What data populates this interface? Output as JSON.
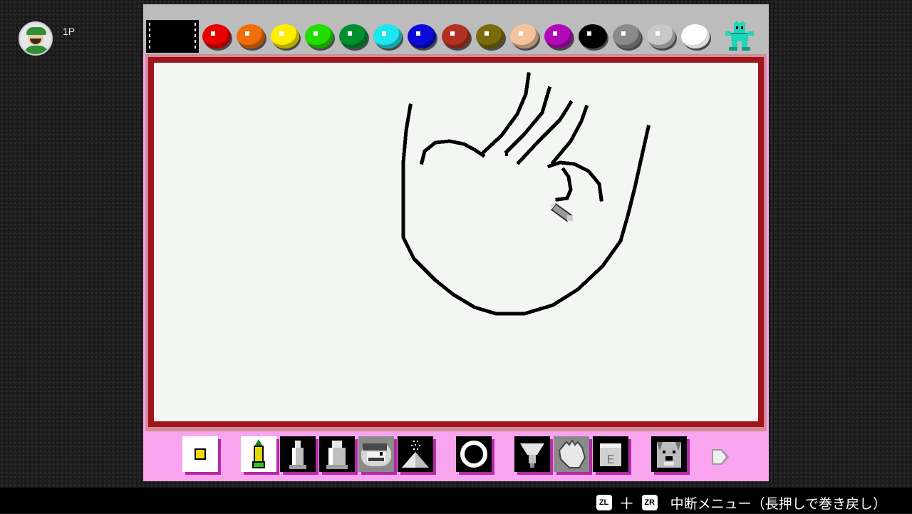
{
  "player": {
    "label": "1P",
    "avatar_icon": "mii-avatar-icon"
  },
  "palette": {
    "colors": [
      "#e80000",
      "#f06d0b",
      "#ffee00",
      "#22dd00",
      "#008f2f",
      "#1ee6ee",
      "#0a0ad8",
      "#b13222",
      "#7a6a0a",
      "#f4c39c",
      "#b00ab8",
      "#000000",
      "#8a8a8a",
      "#c8c8c8",
      "#ffffff"
    ],
    "stamp_icon": "robot-stamp-icon",
    "film_icon": "film-strip-icon"
  },
  "colors": {
    "frame_red": "#a1141c",
    "toolbar_pink": "#f8a4ef",
    "toolbar_shadow": "#b32aa9",
    "canvas": "#f4f6f4"
  },
  "toolbar": {
    "tools": [
      "yellow-square-brush-icon",
      "pencil-icon",
      "marker-icon",
      "thick-marker-icon",
      "mario-stamp-icon",
      "spray-icon",
      "circle-shape-icon",
      "paint-bucket-icon",
      "hand-icon",
      "eraser-icon",
      "dog-stamp-icon"
    ],
    "next_icon": "next-page-arrow-icon"
  },
  "footer": {
    "zl": "ZL",
    "plus": "＋",
    "zr": "ZR",
    "text": "中断メニュー（長押しで巻き戻し）"
  }
}
